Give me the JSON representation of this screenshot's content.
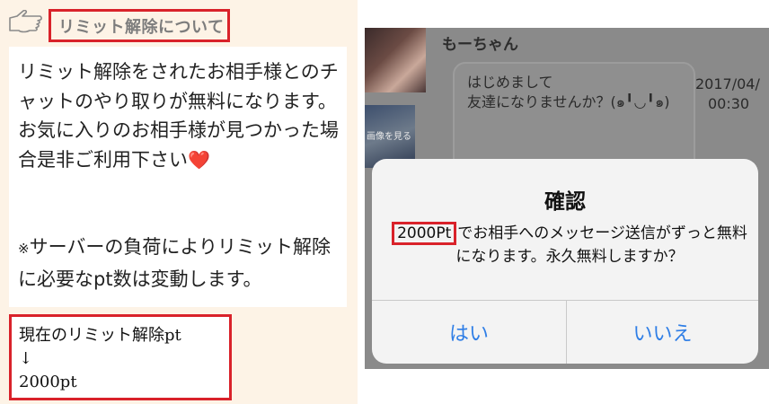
{
  "left": {
    "header": {
      "icon": "pointing-hand-icon",
      "title": "リミット解除について"
    },
    "description": {
      "line1": "リミット解除をされたお相手様とのチャットのやり取りが無料になります。",
      "line2": "お気に入りのお相手様が見つかった場合是非ご利用下さい",
      "heart": "❤️"
    },
    "note": {
      "mark": "※",
      "text": "サーバーの負荷によりリミット解除に必要なpt数は変動します。"
    },
    "current_pt": {
      "label": "現在のリミット解除pt",
      "arrow": "↓",
      "value": "2000pt"
    }
  },
  "right": {
    "chat": {
      "username": "もーちゃん",
      "thumbnail_label": "画像を見る",
      "message_line1": "はじめまして",
      "message_line2": "友達になりませんか？(๑╹◡╹๑)",
      "date": "2017/04/",
      "time": "00:30"
    },
    "dialog": {
      "title": "確認",
      "pt_amount": "2000Pt",
      "message": "でお相手へのメッセージ送信がずっと無料になります。永久無料しますか？",
      "yes_label": "はい",
      "no_label": "いいえ"
    }
  },
  "colors": {
    "highlight_red": "#d9222a",
    "button_blue": "#2f7ee6",
    "left_bg": "#fdf3e6"
  }
}
